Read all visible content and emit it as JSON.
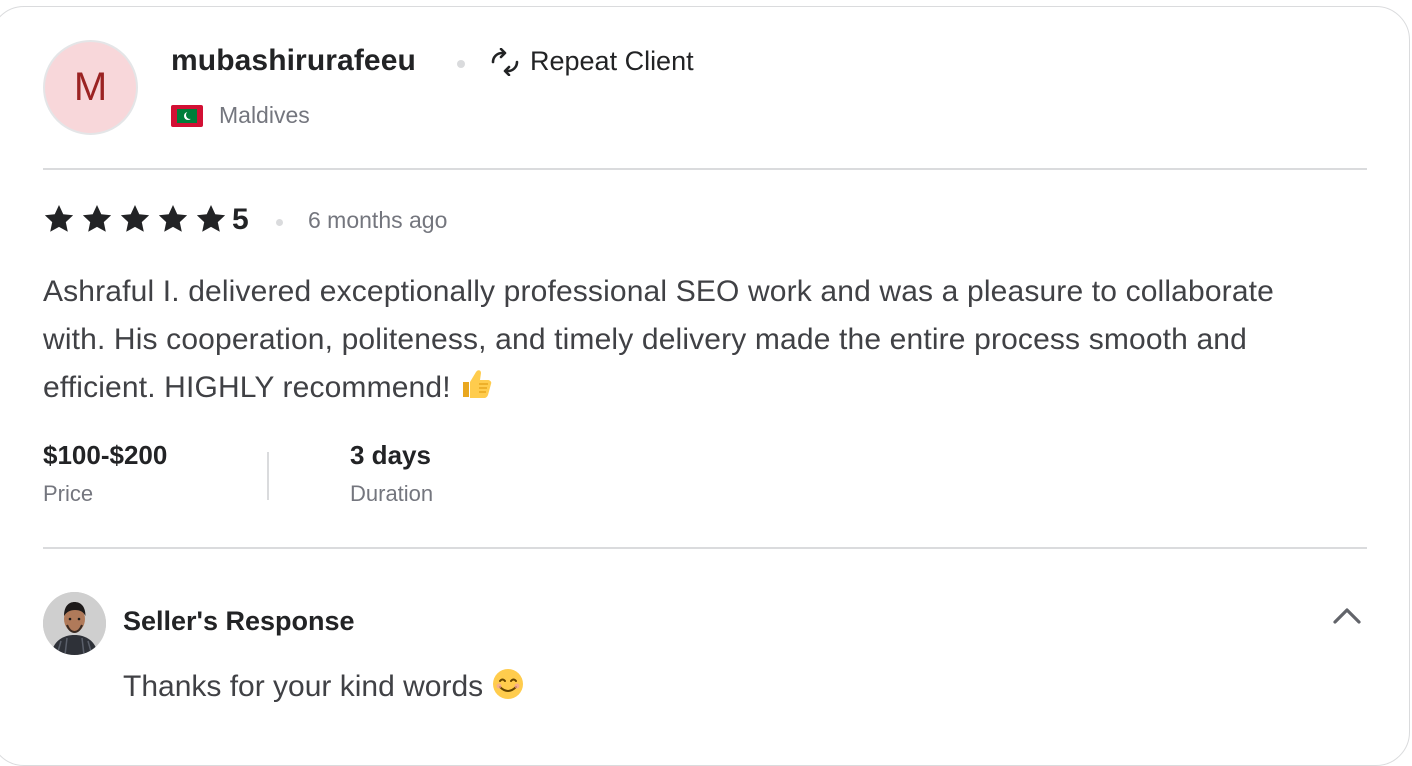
{
  "review": {
    "avatar_letter": "M",
    "username": "mubashirurafeeu",
    "repeat_label": "Repeat Client",
    "country": "Maldives",
    "flag_icon": "maldives-flag-icon",
    "rating": "5",
    "stars": 5,
    "time_ago": "6 months ago",
    "text": "Ashraful I. delivered exceptionally professional SEO work and was a pleasure to collaborate with. His cooperation, politeness, and timely delivery made the entire process smooth and efficient. HIGHLY recommend!",
    "price_value": "$100-$200",
    "price_label": "Price",
    "duration_value": "3 days",
    "duration_label": "Duration"
  },
  "seller_response": {
    "title": "Seller's Response",
    "text": "Thanks for your kind words",
    "expanded": true
  },
  "colors": {
    "avatar_bg": "#f8d7da",
    "avatar_letter": "#9b2323",
    "text_primary": "#222325",
    "text_secondary": "#74767e",
    "divider": "#dadbdd"
  }
}
